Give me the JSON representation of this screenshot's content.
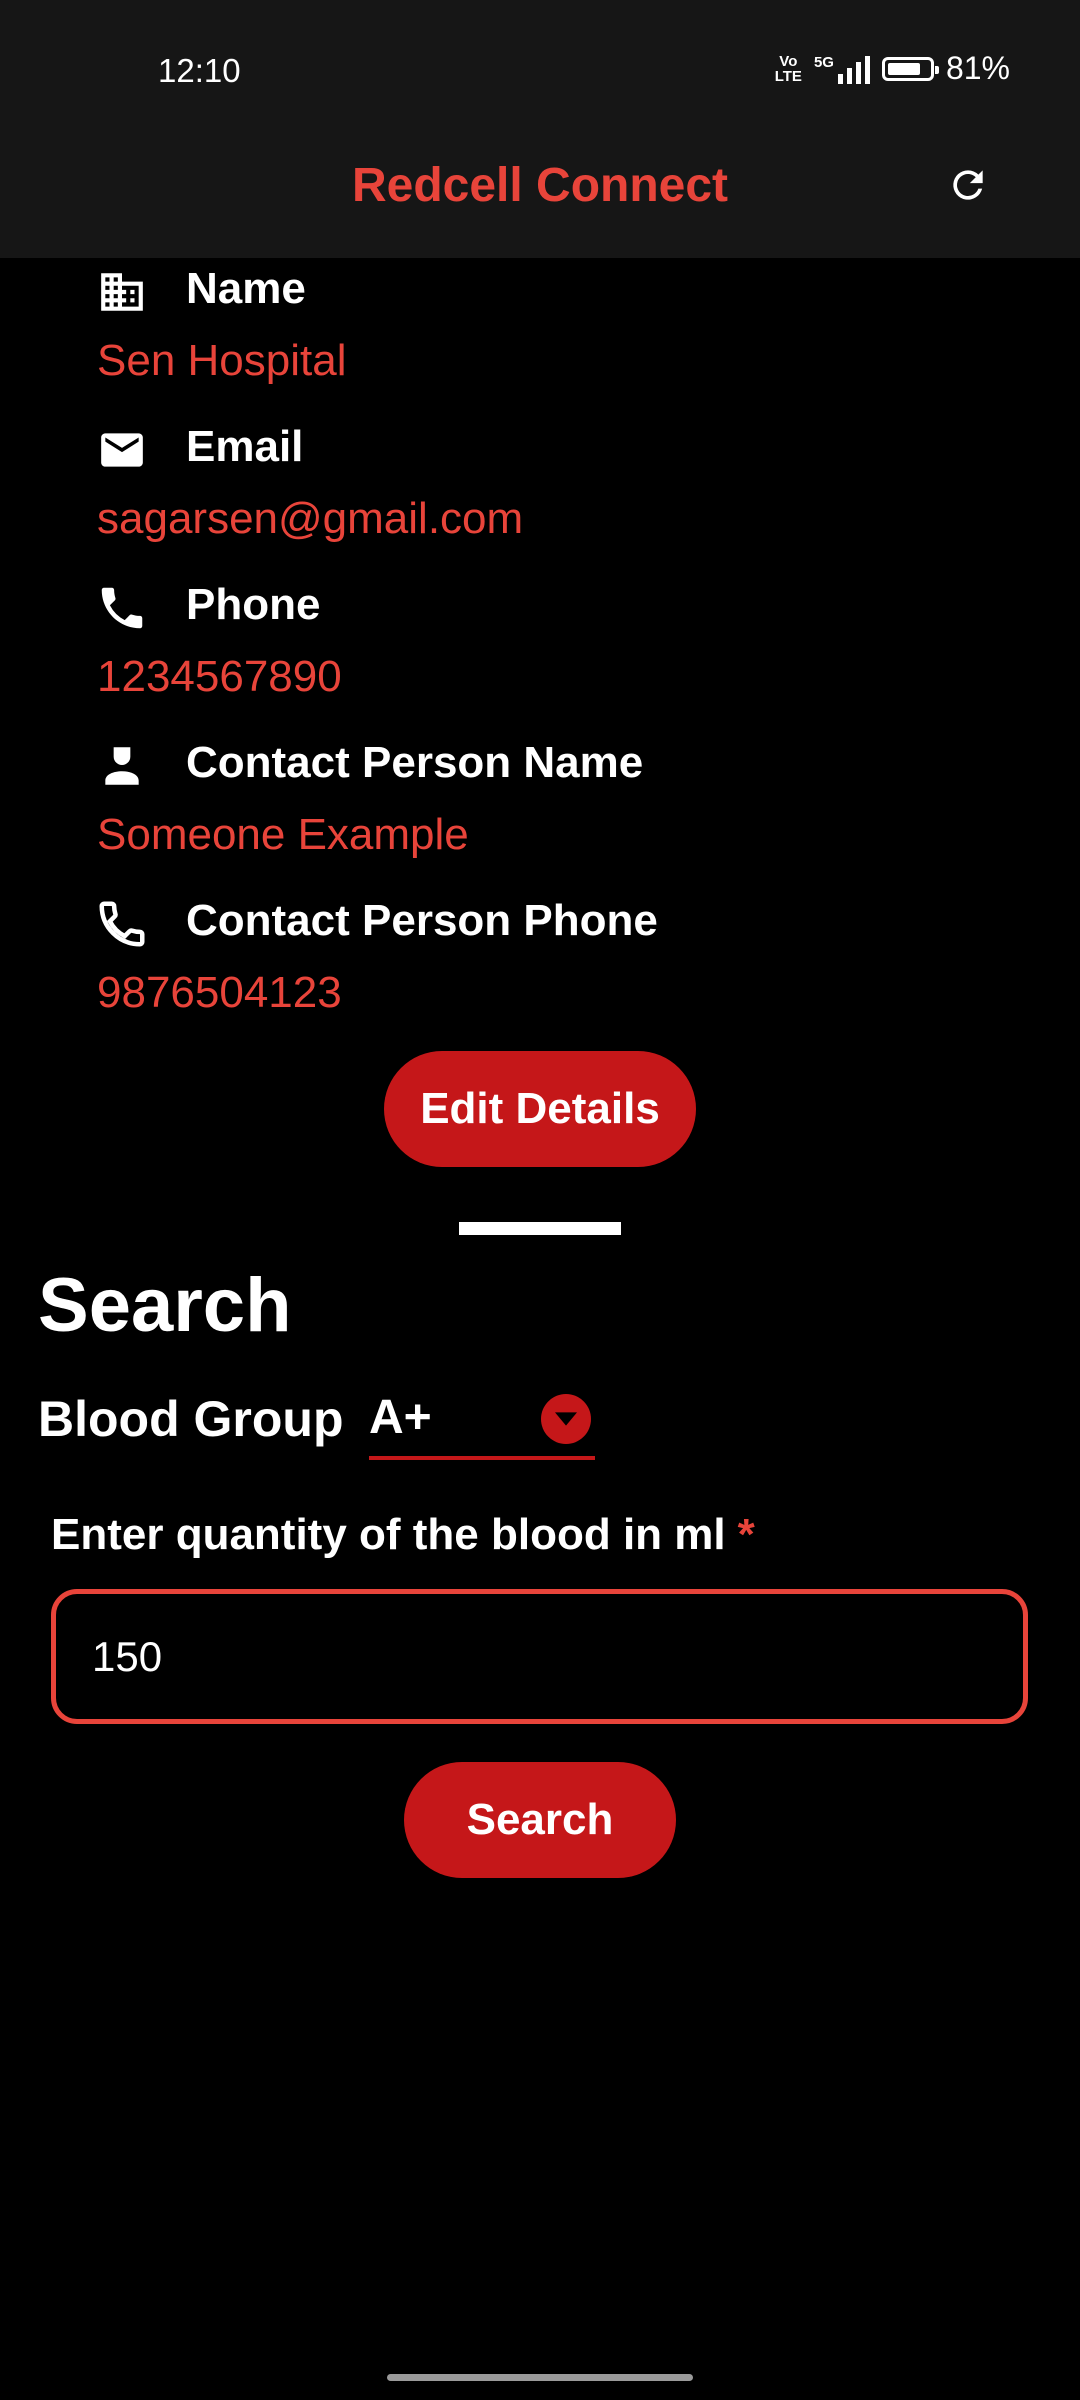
{
  "status_bar": {
    "time": "12:10",
    "volte": "Vo\nLTE",
    "network": "5G",
    "battery_percent_text": "81%",
    "battery_level": 0.81
  },
  "app_bar": {
    "title": "Redcell Connect",
    "refresh_icon": "refresh-icon"
  },
  "details": [
    {
      "icon": "building-icon",
      "label": "Name",
      "value": "Sen Hospital"
    },
    {
      "icon": "mail-icon",
      "label": "Email",
      "value": "sagarsen@gmail.com"
    },
    {
      "icon": "phone-icon",
      "label": "Phone",
      "value": "1234567890"
    },
    {
      "icon": "person-icon",
      "label": "Contact Person Name",
      "value": "Someone Example"
    },
    {
      "icon": "phone-icon",
      "label": "Contact Person Phone",
      "value": "9876504123"
    }
  ],
  "edit_button": "Edit Details",
  "search": {
    "heading": "Search",
    "blood_group_label": "Blood Group",
    "blood_group_value": "A+",
    "quantity_label": "Enter quantity of the blood in ml",
    "required_mark": "*",
    "quantity_value": "150",
    "search_button": "Search"
  },
  "colors": {
    "accent_text": "#e8443a",
    "button_red": "#c51719",
    "background": "#000000",
    "app_bar": "#161616"
  }
}
